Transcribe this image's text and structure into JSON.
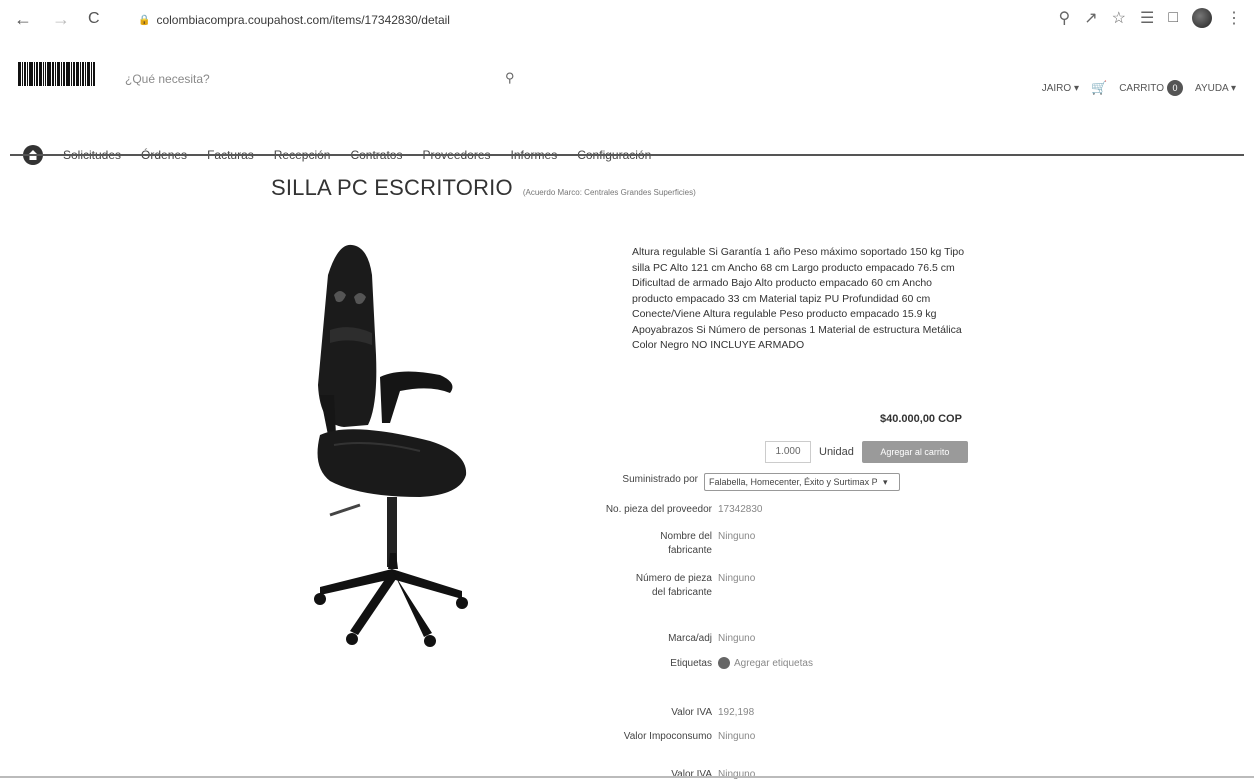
{
  "browser": {
    "back": "←",
    "forward": "→",
    "reload": "C",
    "url": "colombiacompra.coupahost.com/items/17342830/detail"
  },
  "header": {
    "search_placeholder": "¿Qué necesita?",
    "user_name": "JAIRO",
    "cart_label": "CARRITO",
    "cart_count": "0",
    "help_label": "AYUDA"
  },
  "menu": {
    "items": [
      "Solicitudes",
      "Órdenes",
      "Facturas",
      "Recepción",
      "Contratos",
      "Proveedores",
      "Informes",
      "Configuración"
    ]
  },
  "product": {
    "title": "SILLA PC ESCRITORIO",
    "breadcrumb": "(Acuerdo Marco: Centrales Grandes Superficies)",
    "description": "Altura regulable Si Garantía 1 año Peso máximo soportado 150 kg Tipo silla PC Alto 121 cm Ancho 68 cm Largo producto empacado 76.5 cm Dificultad de armado Bajo Alto producto empacado 60 cm Ancho producto empacado 33 cm Material tapiz PU Profundidad 60 cm Conecte/Viene Altura regulable Peso producto empacado 15.9 kg Apoyabrazos Si Número de personas 1 Material de estructura Metálica Color Negro NO INCLUYE ARMADO",
    "price": "$40.000,00 COP",
    "quantity": "1.000",
    "unit": "Unidad",
    "add_button": "Agregar al carrito"
  },
  "details": {
    "supplier_label": "Suministrado por",
    "supplier_value": "Falabella, Homecenter, Éxito y Surtimax Pérez",
    "part_label": "No. pieza del proveedor",
    "part_value": "17342830",
    "manufacturer_label": "Nombre del fabricante",
    "manufacturer_value": "Ninguno",
    "mpn_label": "Número de pieza del fabricante",
    "mpn_value": "Ninguno",
    "brand_label": "Marca/adj",
    "brand_value": "Ninguno",
    "tags_label": "Etiquetas",
    "tags_value": "Agregar etiquetas",
    "iva_label": "Valor IVA",
    "iva_value": "192,198",
    "valor_label": "Valor Impoconsumo",
    "valor_value": "Ninguno",
    "ica_label": "Valor IVA",
    "ica_value": "Ninguno"
  },
  "colors": {
    "button_gray": "#9a9a9a",
    "text_dark": "#333333",
    "accent": "#555555"
  }
}
